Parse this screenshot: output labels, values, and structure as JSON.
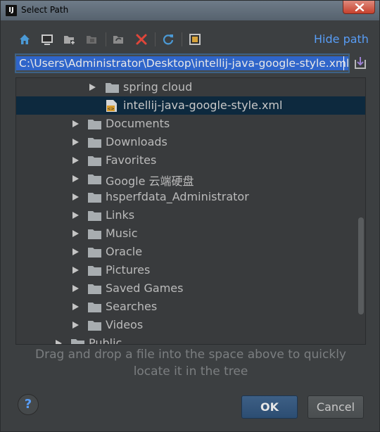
{
  "window": {
    "title": "Select Path",
    "app_icon_text": "IJ"
  },
  "toolbar": {
    "hide_path_label": "Hide path",
    "icons": [
      "home-icon",
      "desktop-icon",
      "new-folder-icon",
      "project-folder-icon",
      "folder-refresh-icon",
      "delete-icon",
      "refresh-icon",
      "show-hidden-icon"
    ]
  },
  "path": {
    "value": "C:\\Users\\Administrator\\Desktop\\intellij-java-google-style.xml"
  },
  "tree": {
    "items": [
      {
        "label": "spring cloud",
        "type": "folder"
      },
      {
        "label": "intellij-java-google-style.xml",
        "type": "xml-file",
        "selected": true
      },
      {
        "label": "Documents",
        "type": "folder"
      },
      {
        "label": "Downloads",
        "type": "folder"
      },
      {
        "label": "Favorites",
        "type": "folder"
      },
      {
        "label": "Google 云端硬盘",
        "type": "folder"
      },
      {
        "label": "hsperfdata_Administrator",
        "type": "folder"
      },
      {
        "label": "Links",
        "type": "folder"
      },
      {
        "label": "Music",
        "type": "folder"
      },
      {
        "label": "Oracle",
        "type": "folder"
      },
      {
        "label": "Pictures",
        "type": "folder"
      },
      {
        "label": "Saved Games",
        "type": "folder"
      },
      {
        "label": "Searches",
        "type": "folder"
      },
      {
        "label": "Videos",
        "type": "folder"
      },
      {
        "label": "Public",
        "type": "folder"
      }
    ]
  },
  "hint": {
    "line1": "Drag and drop a file into the space above to quickly",
    "line2": "locate it in the tree"
  },
  "buttons": {
    "help": "?",
    "ok": "OK",
    "cancel": "Cancel"
  },
  "colors": {
    "accent": "#589df6",
    "selection": "#2f65ca",
    "tree_selected": "#0d293e",
    "background": "#3c3f41"
  }
}
